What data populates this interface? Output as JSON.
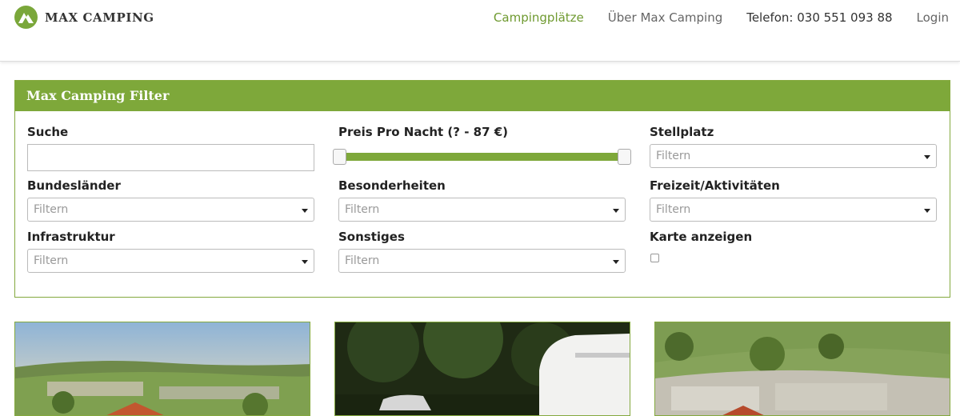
{
  "brand": {
    "name": "MAX CAMPING"
  },
  "nav": {
    "items": [
      "Campingplätze",
      "Über Max Camping",
      "Telefon: 030 551 093 88",
      "Login"
    ]
  },
  "filter": {
    "title": "Max Camping Filter",
    "search_label": "Suche",
    "search_value": "",
    "price_label": "Preis Pro Nacht (? - 87 €)",
    "price_range": {
      "low": 0,
      "high": 1
    },
    "fields": [
      {
        "label": "Stellplatz",
        "placeholder": "Filtern"
      },
      {
        "label": "Bundesländer",
        "placeholder": "Filtern"
      },
      {
        "label": "Besonderheiten",
        "placeholder": "Filtern"
      },
      {
        "label": "Freizeit/Aktivitäten",
        "placeholder": "Filtern"
      },
      {
        "label": "Infrastruktur",
        "placeholder": "Filtern"
      },
      {
        "label": "Sonstiges",
        "placeholder": "Filtern"
      }
    ],
    "map_label": "Karte anzeigen",
    "map_checked": false
  },
  "colors": {
    "accent": "#7ea83a",
    "nav_active": "#6f9a30"
  }
}
